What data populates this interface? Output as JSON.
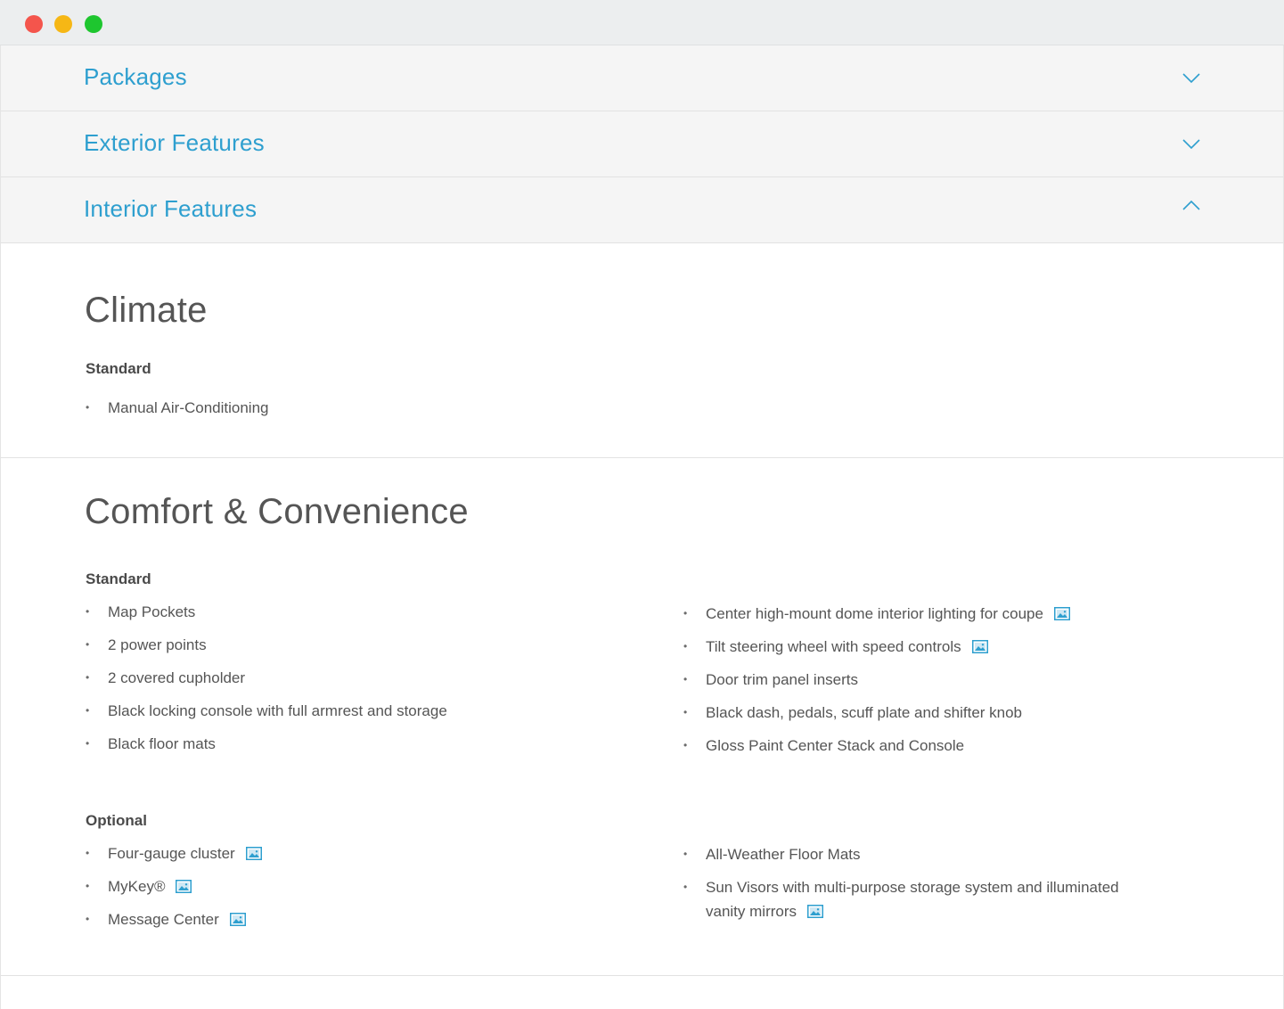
{
  "window": {
    "controls": [
      "close",
      "minimize",
      "maximize"
    ]
  },
  "accordion": [
    {
      "label": "Packages",
      "state": "collapsed",
      "icon": "chevron-down-icon"
    },
    {
      "label": "Exterior Features",
      "state": "collapsed",
      "icon": "chevron-down-icon"
    },
    {
      "label": "Interior Features",
      "state": "expanded",
      "icon": "chevron-up-icon"
    }
  ],
  "climate": {
    "title": "Climate",
    "standard_label": "Standard",
    "standard": [
      {
        "text": "Manual Air-Conditioning",
        "has_image": false
      }
    ]
  },
  "comfort": {
    "title": "Comfort & Convenience",
    "standard_label": "Standard",
    "standard_left": [
      {
        "text": "Map Pockets",
        "has_image": false
      },
      {
        "text": "2 power points",
        "has_image": false
      },
      {
        "text": "2 covered cupholder",
        "has_image": false
      },
      {
        "text": "Black locking console with full armrest and storage",
        "has_image": false
      },
      {
        "text": "Black floor mats",
        "has_image": false
      }
    ],
    "standard_right": [
      {
        "text": "Center high-mount dome interior lighting for coupe",
        "has_image": true
      },
      {
        "text": "Tilt steering wheel with speed controls",
        "has_image": true
      },
      {
        "text": "Door trim panel inserts",
        "has_image": false
      },
      {
        "text": "Black dash, pedals, scuff plate and shifter knob",
        "has_image": false
      },
      {
        "text": "Gloss Paint Center Stack and Console",
        "has_image": false
      }
    ],
    "optional_label": "Optional",
    "optional_left": [
      {
        "text": "Four-gauge cluster",
        "has_image": true
      },
      {
        "text": "MyKey®",
        "has_image": true
      },
      {
        "text": "Message Center",
        "has_image": true
      }
    ],
    "optional_right": [
      {
        "text": "All-Weather Floor Mats",
        "has_image": false
      },
      {
        "text": "Sun Visors with multi-purpose storage system and illuminated",
        "has_image": false
      },
      {
        "text": "vanity mirrors",
        "has_image": true
      }
    ]
  },
  "colors": {
    "accent": "#2e9fcf",
    "text": "#555555",
    "accordion_bg": "#f5f5f5"
  }
}
